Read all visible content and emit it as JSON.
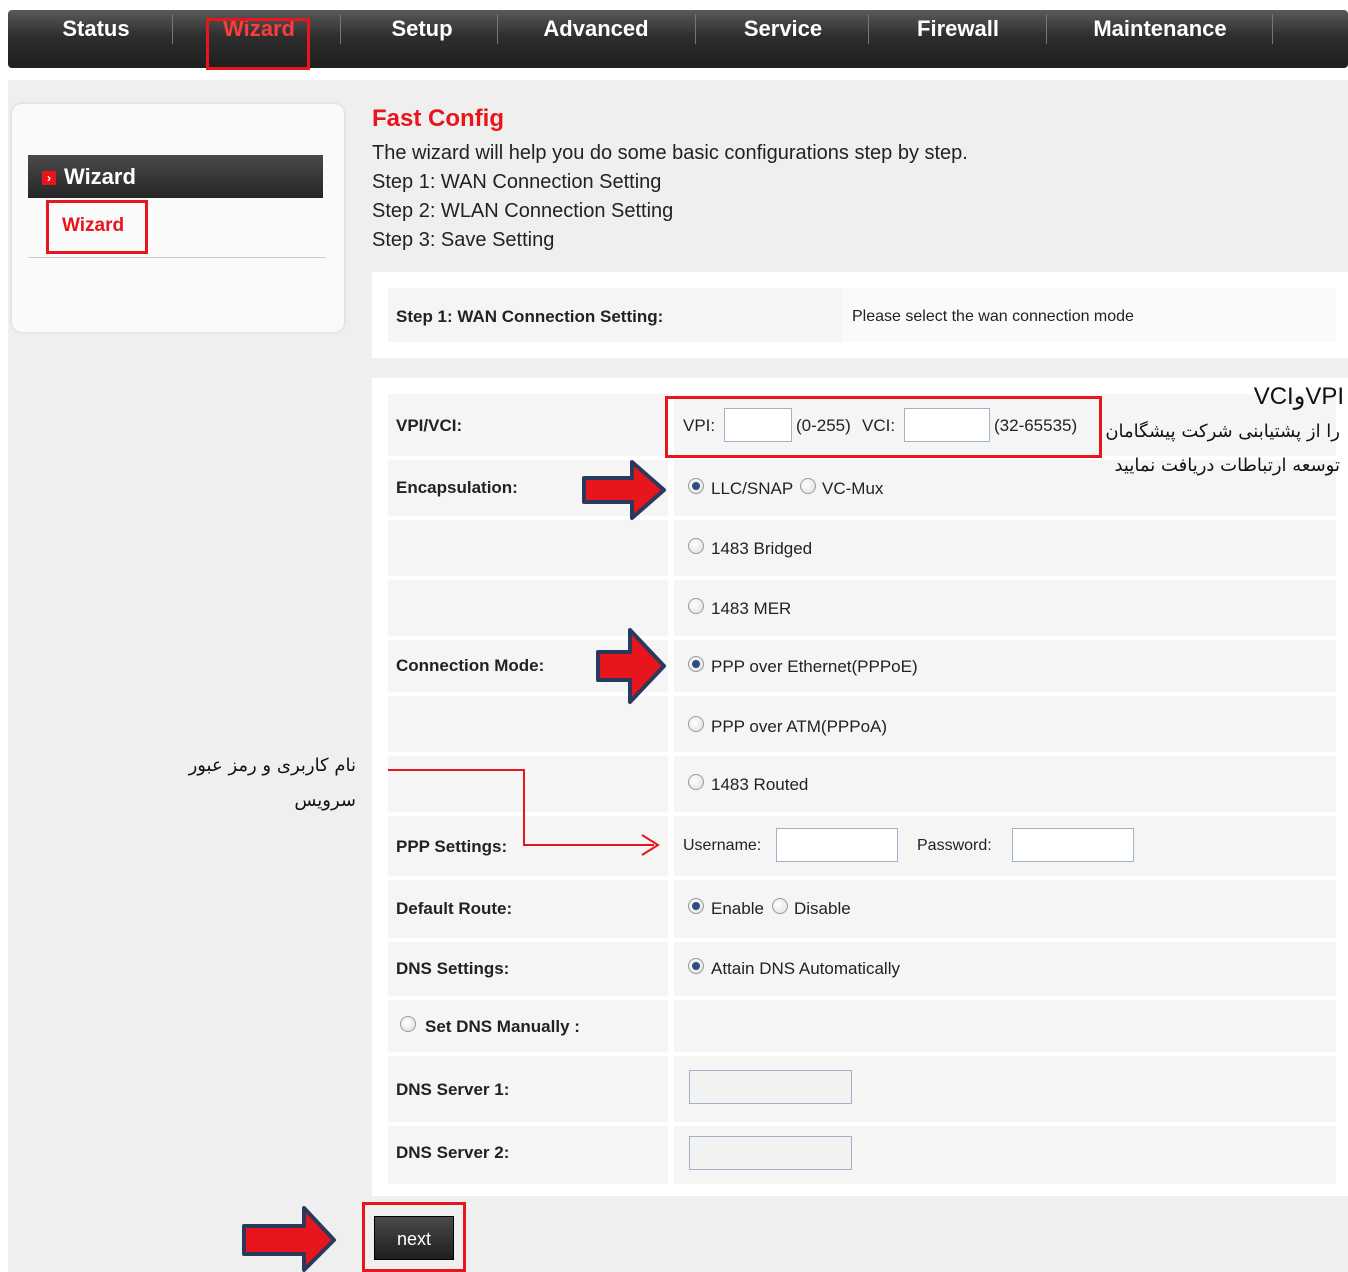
{
  "nav": {
    "items": [
      "Status",
      "Wizard",
      "Setup",
      "Advanced",
      "Service",
      "Firewall",
      "Maintenance"
    ],
    "active": "Wizard"
  },
  "sidebar": {
    "heading": "Wizard",
    "sub": "Wizard"
  },
  "main": {
    "title": "Fast Config",
    "intro": [
      "The wizard will help you do some basic configurations step by step.",
      "Step 1: WAN Connection Setting",
      "Step 2: WLAN Connection Setting",
      "Step 3: Save Setting"
    ],
    "step_label": "Step 1: WAN Connection Setting:",
    "step_hint": "Please select the wan connection mode"
  },
  "form": {
    "vpivci_label": "VPI/VCI:",
    "vpi_label": "VPI:",
    "vpi_value": "",
    "vpi_range": "(0-255)",
    "vci_label": "VCI:",
    "vci_value": "",
    "vci_range": "(32-65535)",
    "encap_label": "Encapsulation:",
    "encap_llc": "LLC/SNAP",
    "encap_vcmux": "VC-Mux",
    "conn_mode_label": "Connection Mode:",
    "mode_1483_bridged": "1483 Bridged",
    "mode_1483_mer": "1483 MER",
    "mode_pppoe": "PPP over Ethernet(PPPoE)",
    "mode_pppoa": "PPP over ATM(PPPoA)",
    "mode_1483_routed": "1483 Routed",
    "ppp_label": "PPP Settings:",
    "username_label": "Username:",
    "username_value": "",
    "password_label": "Password:",
    "password_value": "",
    "default_route_label": "Default Route:",
    "enable": "Enable",
    "disable": "Disable",
    "dns_label": "DNS Settings:",
    "dns_auto": "Attain DNS Automatically",
    "dns_manual": "Set DNS Manually :",
    "dns1_label": "DNS Server 1:",
    "dns1_value": "",
    "dns2_label": "DNS Server 2:",
    "dns2_value": "",
    "next": "next"
  },
  "annotations": {
    "vpi_note_title": "VPIوVCI",
    "vpi_note_line1": "را از پشتیابنی شرکت پیشگامان",
    "vpi_note_line2": "توسعه ارتباطات دریافت نمایید",
    "ppp_note_line1": "نام کاربری و رمز عبور",
    "ppp_note_line2": "سرویس"
  },
  "colors": {
    "accent_red": "#e8151c",
    "nav_dark": "#2e2e2e",
    "arrow_blue": "#2a3a5c"
  }
}
